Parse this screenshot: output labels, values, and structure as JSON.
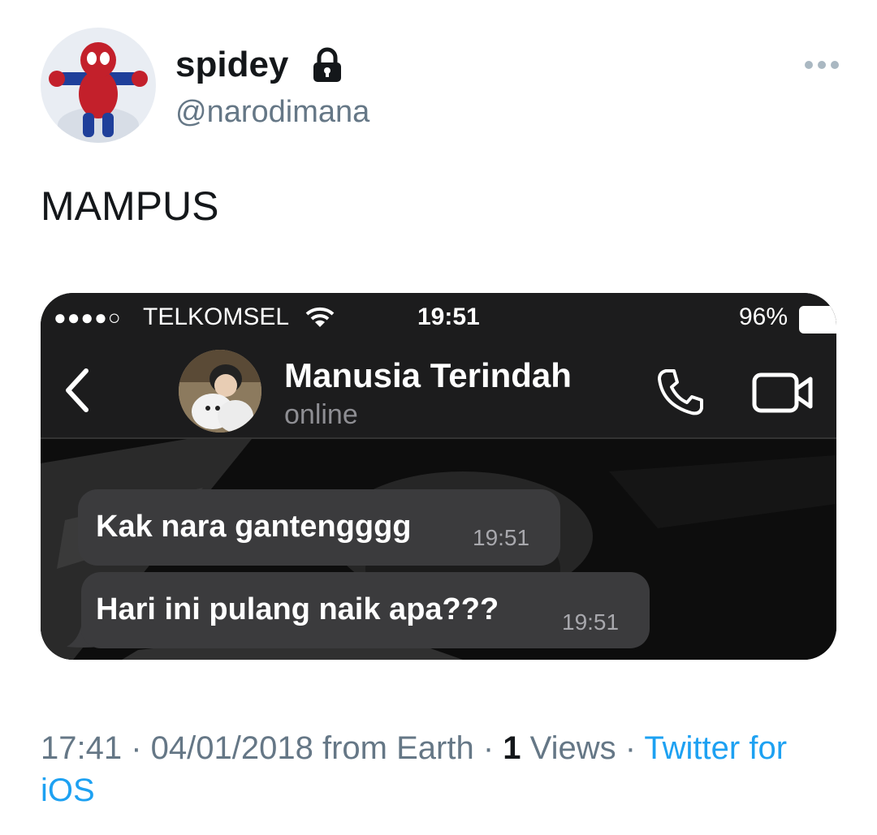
{
  "tweet": {
    "display_name": "spidey",
    "handle": "@narodimana",
    "text": "MAMPUS",
    "icons": {
      "protected": "lock-icon",
      "more": "more-icon"
    }
  },
  "embedded_screenshot": {
    "status_bar": {
      "signal": "●●●●○",
      "carrier": "TELKOMSEL",
      "time": "19:51",
      "battery": "96%"
    },
    "chat_header": {
      "contact_name": "Manusia Terindah",
      "status": "online"
    },
    "messages": [
      {
        "text": "Kak nara gantengggg",
        "time": "19:51"
      },
      {
        "text": "Hari ini pulang naik apa???",
        "time": "19:51"
      }
    ]
  },
  "footer": {
    "time": "17:41",
    "sep1": " · ",
    "date": "04/01/2018",
    "location": " from Earth",
    "sep2": " · ",
    "views_count": "1",
    "views_label": " Views",
    "sep3": " · ",
    "source": "Twitter for iOS"
  },
  "colors": {
    "link": "#1da1f2",
    "secondary": "#657786",
    "bubble": "#3b3b3d"
  }
}
